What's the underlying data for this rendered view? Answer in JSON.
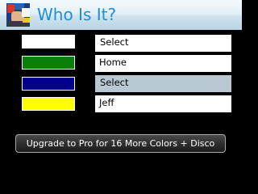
{
  "app": {
    "title": "Who Is It?",
    "icon": "app-logo-icon"
  },
  "rows": [
    {
      "color": "#ffffff",
      "value": "Select",
      "kind": "dropdown",
      "focused": false
    },
    {
      "color": "#0a800a",
      "value": "Home",
      "kind": "text-input",
      "focused": false
    },
    {
      "color": "#00008c",
      "value": "Select",
      "kind": "dropdown",
      "focused": true
    },
    {
      "color": "#ffff00",
      "value": "Jeff",
      "kind": "text-input",
      "focused": false
    }
  ],
  "upgrade_button": {
    "label": "Upgrade to Pro for 16 More Colors + Disco"
  },
  "colors": {
    "title_text": "#1d8fd0",
    "background": "#000000",
    "focus_highlight": "#b8c9d4"
  }
}
